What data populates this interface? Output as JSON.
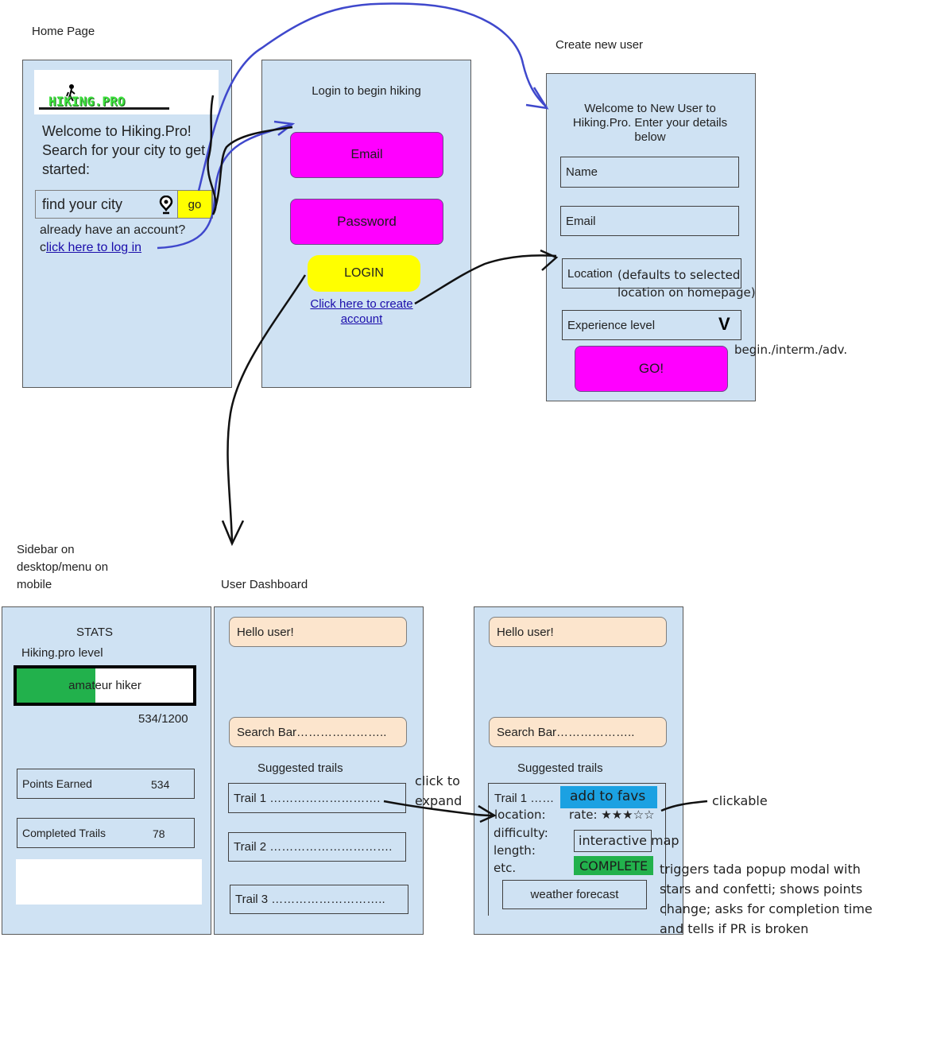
{
  "captions": {
    "home": "Home Page",
    "create_user": "Create new user",
    "sidebar": "Sidebar on desktop/menu on mobile",
    "dashboard": "User Dashboard"
  },
  "home": {
    "logo_text": "HIKING.PRO",
    "welcome": "Welcome to Hiking.Pro! Search for your city to get started:",
    "search_placeholder": "find your city",
    "go": "go",
    "have_account": "already have an account?",
    "login_prefix": "c",
    "login_link": "lick here to log in"
  },
  "login": {
    "title": "Login to begin hiking",
    "email": "Email",
    "password": "Password",
    "login_button": "LOGIN",
    "create_link": "Click here to create account"
  },
  "create": {
    "welcome": "Welcome to New User to Hiking.Pro. Enter your details below",
    "name": "Name",
    "email": "Email",
    "location": "Location",
    "location_note": "(defaults to selected location on homepage)",
    "experience": "Experience level",
    "experience_check": "V",
    "experience_options": "begin./interm./adv.",
    "go": "GO!"
  },
  "sidebar": {
    "stats": "STATS",
    "level_label": "Hiking.pro level",
    "level_name": "amateur hiker",
    "points_progress": "534/1200",
    "progress_fraction": 0.445,
    "points_label": "Points Earned",
    "points_value": "534",
    "completed_label": "Completed Trails",
    "completed_value": "78"
  },
  "dashboard": {
    "hello": "Hello user!",
    "search": "Search Bar…………………..",
    "suggested": "Suggested trails",
    "trails": [
      "Trail 1 ……………………….",
      "Trail 2 ………………………….",
      "Trail 3 ……………………….."
    ]
  },
  "expanded": {
    "hello": "Hello user!",
    "search": "Search Bar………………..",
    "suggested": "Suggested trails",
    "trail1": "Trail 1 ……",
    "add_favs": "add to favs",
    "location": "location:",
    "difficulty": "difficulty:",
    "length": "length:",
    "etc": "etc.",
    "rate": "rate: ★★★☆☆",
    "map": "interactive map",
    "complete": "COMPLETE",
    "weather": "weather forecast"
  },
  "notes": {
    "click_expand": "click to expand",
    "clickable": "clickable",
    "complete_note": "triggers tada popup modal with stars and confetti; shows points change; asks for completion time and tells if PR is broken"
  },
  "colors": {
    "panel": "#cfe2f3",
    "pink": "#ff00ff",
    "yellow": "#ffff00",
    "green": "#22b14c",
    "peach": "#fce5cd",
    "blue_button": "#1ba1e2",
    "arrow_blue": "#3f48cc"
  }
}
